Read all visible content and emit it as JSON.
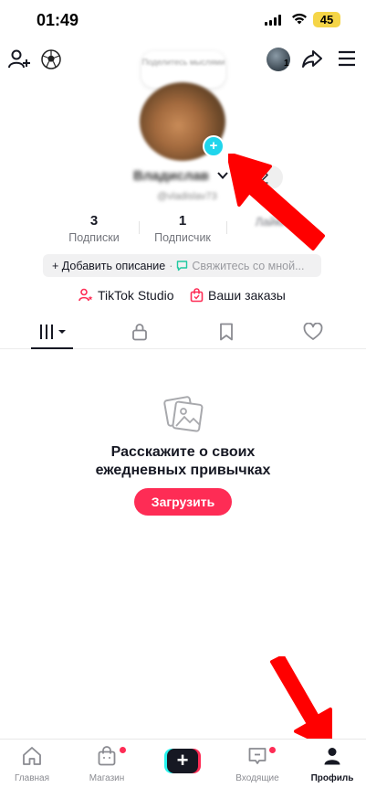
{
  "status_bar": {
    "time": "01:49",
    "battery": "45"
  },
  "header": {
    "add_friend_icon": "person-plus-icon",
    "sticker_icon": "soccer-ball-icon",
    "share_icon": "share-arrow-icon",
    "menu_icon": "hamburger-menu-icon",
    "avatar_badge": "1"
  },
  "profile": {
    "note_bubble": "Поделитесь мыслями",
    "name": "Владислав",
    "username": "@vladislav73"
  },
  "stats": [
    {
      "value": "3",
      "label": "Подписки"
    },
    {
      "value": "1",
      "label": "Подписчик"
    },
    {
      "value": "",
      "label": "Лайки"
    }
  ],
  "bio": {
    "add_description": "+ Добавить описание",
    "separator": "·",
    "contact": "Свяжитесь со мной..."
  },
  "links": {
    "studio": "TikTok Studio",
    "orders": "Ваши заказы"
  },
  "tabs": [
    {
      "icon": "videos-grid-icon",
      "active": true
    },
    {
      "icon": "lock-icon",
      "active": false
    },
    {
      "icon": "bookmark-icon",
      "active": false
    },
    {
      "icon": "heart-icon",
      "active": false
    }
  ],
  "empty_state": {
    "title_line1": "Расскажите о своих",
    "title_line2": "ежедневных привычках",
    "button": "Загрузить"
  },
  "bottom_nav": [
    {
      "label": "Главная",
      "icon": "home-icon"
    },
    {
      "label": "Магазин",
      "icon": "shop-bag-icon",
      "badge": true
    },
    {
      "label": "",
      "icon": "create-plus-icon"
    },
    {
      "label": "Входящие",
      "icon": "inbox-icon",
      "badge": true
    },
    {
      "label": "Профиль",
      "icon": "profile-icon",
      "active": true
    }
  ],
  "colors": {
    "accent": "#fe2c55",
    "cyan": "#25f4ee",
    "text": "#161823",
    "arrow": "#ff0000"
  }
}
